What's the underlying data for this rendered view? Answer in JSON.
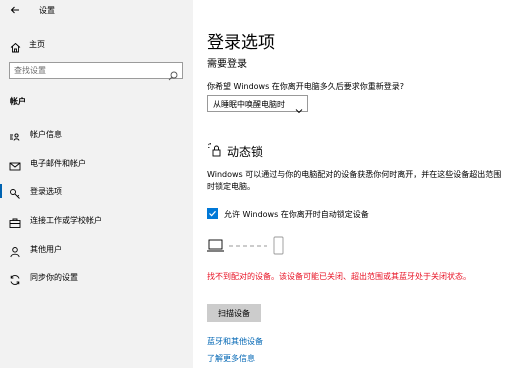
{
  "app": {
    "title": "设置"
  },
  "sidebar": {
    "home_label": "主页",
    "search_placeholder": "查找设置",
    "section_header": "帐户",
    "items": [
      {
        "label": "帐户信息",
        "icon": "account-info-icon"
      },
      {
        "label": "电子邮件和帐户",
        "icon": "email-icon"
      },
      {
        "label": "登录选项",
        "icon": "key-icon",
        "active": true
      },
      {
        "label": "连接工作或学校帐户",
        "icon": "briefcase-icon"
      },
      {
        "label": "其他用户",
        "icon": "person-icon"
      },
      {
        "label": "同步你的设置",
        "icon": "sync-icon"
      }
    ]
  },
  "main": {
    "title": "登录选项",
    "subheading": "需要登录",
    "question": "你希望 Windows 在你离开电脑多久后要求你重新登录?",
    "dropdown_value": "从睡眠中唤醒电脑时",
    "dynamic_lock": {
      "title": "动态锁",
      "description": "Windows 可以通过与你的电脑配对的设备获悉你何时离开，并在这些设备超出范围时锁定电脑。",
      "checkbox_label": "允许 Windows 在你离开时自动锁定设备",
      "checkbox_checked": true,
      "error": "找不到配对的设备。该设备可能已关闭、超出范围或其蓝牙处于关闭状态。",
      "scan_button": "扫描设备"
    },
    "links": {
      "bluetooth": "蓝牙和其他设备",
      "learn_more": "了解更多信息"
    }
  },
  "colors": {
    "accent": "#0078d7",
    "error": "#e81123",
    "link": "#0066b4"
  }
}
